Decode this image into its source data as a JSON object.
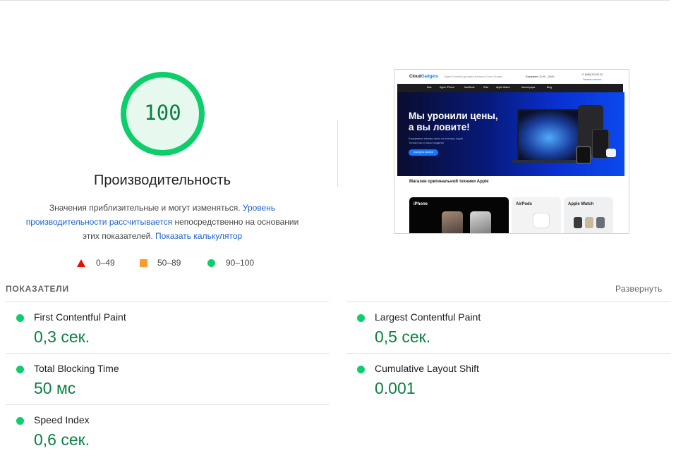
{
  "score": {
    "value": "100",
    "title": "Производительность",
    "color_pass": "#0cce6b",
    "color_text": "#0b8043"
  },
  "description": {
    "text1": "Значения приблизительные и могут изменяться. ",
    "link1": "Уровень производительности рассчитывается",
    "text2": " непосредственно на основании этих показателей. ",
    "link2": "Показать калькулятор"
  },
  "legend": {
    "fail": "0–49",
    "average": "50–89",
    "pass": "90–100"
  },
  "screenshot": {
    "logo_main": "Cloud",
    "logo_accent": "Gadgets",
    "header_links": "Гарант   Оплата и доставка   Контакты   О нас   Отзывы",
    "header_right": "Ежедневно  11:00 – 20:00",
    "phone": "+7 (995) 223-02-20",
    "call": "Заказать звонок",
    "nav": [
      "Mac",
      "Apple iPhone",
      "MacBook",
      "iPad",
      "Apple Watch",
      "Аксессуары",
      "Blog"
    ],
    "banner_title_1": "Мы уронили цены,",
    "banner_title_2": "а вы ловите!",
    "banner_sub_1": "Ежедневно низкие цены на технику Apple",
    "banner_sub_2": "Только мы и наши гаджеты",
    "banner_button": "Смотреть каталог",
    "shop_title": "Магазин оригинальной техники Apple",
    "cards": [
      "iPhone",
      "AirPods",
      "Apple Watch"
    ]
  },
  "metrics": {
    "section_title": "ПОКАЗАТЕЛИ",
    "expand": "Развернуть",
    "items": [
      {
        "label": "First Contentful Paint",
        "value": "0,3 сек."
      },
      {
        "label": "Largest Contentful Paint",
        "value": "0,5 сек."
      },
      {
        "label": "Total Blocking Time",
        "value": "50 мс"
      },
      {
        "label": "Cumulative Layout Shift",
        "value": "0.001"
      },
      {
        "label": "Speed Index",
        "value": "0,6 сек."
      }
    ]
  }
}
